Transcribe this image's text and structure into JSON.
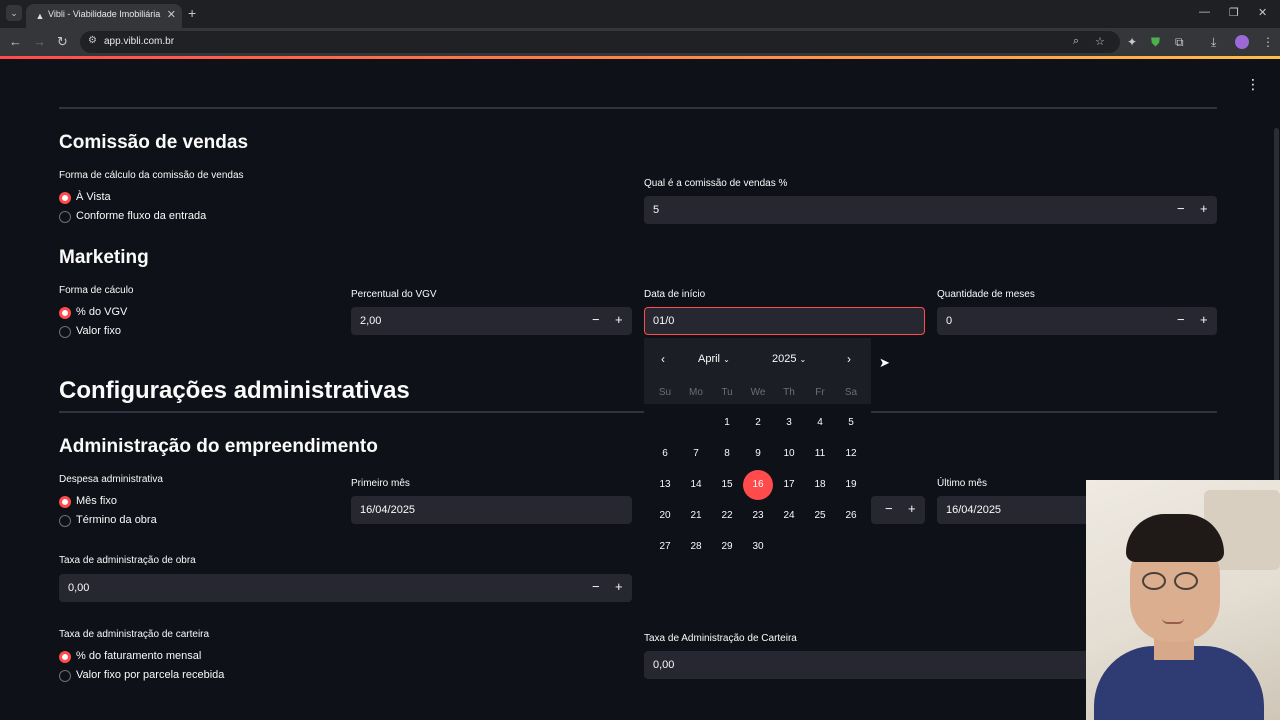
{
  "browser": {
    "tab_title": "Vibli - Viabilidade Imobiliária",
    "url": "app.vibli.com.br"
  },
  "comissao": {
    "heading": "Comissão de vendas",
    "radio_label": "Forma de cálculo da comissão de vendas",
    "options": [
      "À Vista",
      "Conforme fluxo da entrada"
    ],
    "selected": 0,
    "pct_label": "Qual é a comissão de vendas %",
    "pct_value": "5"
  },
  "marketing": {
    "heading": "Marketing",
    "radio_label": "Forma de cáculo",
    "options": [
      "% do VGV",
      "Valor fixo"
    ],
    "selected": 0,
    "pct_label": "Percentual do VGV",
    "pct_value": "2,00",
    "date_label": "Data de início",
    "date_value": "01/0",
    "months_label": "Quantidade de meses",
    "months_value": "0"
  },
  "calendar": {
    "month": "April",
    "year": "2025",
    "weekdays": [
      "Su",
      "Mo",
      "Tu",
      "We",
      "Th",
      "Fr",
      "Sa"
    ],
    "days": [
      "1",
      "2",
      "3",
      "4",
      "5",
      "6",
      "7",
      "8",
      "9",
      "10",
      "11",
      "12",
      "13",
      "14",
      "15",
      "16",
      "17",
      "18",
      "19",
      "20",
      "21",
      "22",
      "23",
      "24",
      "25",
      "26",
      "27",
      "28",
      "29",
      "30"
    ],
    "selected_day": "16"
  },
  "admin": {
    "heading": "Configurações administrativas",
    "sub_heading": "Administração do empreendimento",
    "despesa_label": "Despesa administrativa",
    "despesa_options": [
      "Mês fixo",
      "Término da obra"
    ],
    "despesa_selected": 0,
    "primeiro_label": "Primeiro mês",
    "primeiro_value": "16/04/2025",
    "ultimo_label": "Último mês",
    "ultimo_value": "16/04/2025",
    "taxa_obra_label": "Taxa de administração de obra",
    "taxa_obra_value": "0,00",
    "carteira_label": "Taxa de administração de carteira",
    "carteira_options": [
      "% do faturamento mensal",
      "Valor fixo por parcela recebida"
    ],
    "carteira_selected": 0,
    "taxa_carteira_label": "Taxa de Administração de Carteira",
    "taxa_carteira_value": "0,00"
  },
  "colors": {
    "background": "#0e1117",
    "input": "#262730",
    "accent": "#ff4b4b"
  }
}
